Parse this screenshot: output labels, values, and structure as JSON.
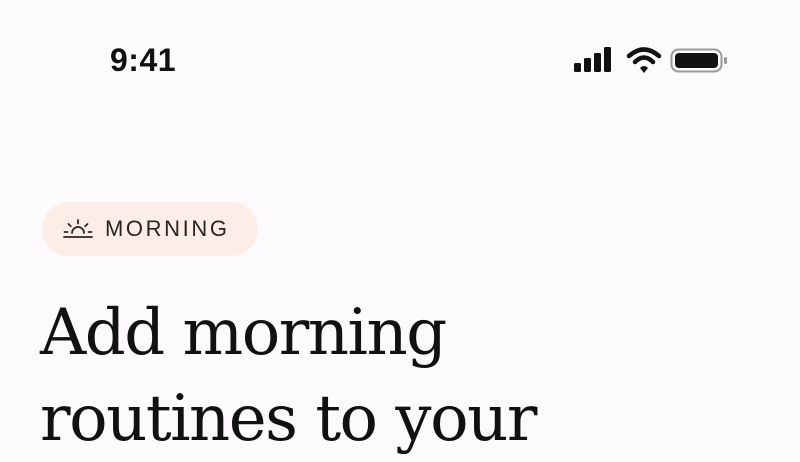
{
  "status_bar": {
    "time": "9:41",
    "icons": [
      "cellular-signal-icon",
      "wifi-icon",
      "battery-icon"
    ]
  },
  "badge": {
    "icon": "sunrise-icon",
    "label": "MORNING",
    "background_color": "#fcede6"
  },
  "headline": {
    "lines": [
      "Add morning",
      "routines to your"
    ]
  },
  "colors": {
    "background": "#fcfafc",
    "text": "#111111"
  }
}
